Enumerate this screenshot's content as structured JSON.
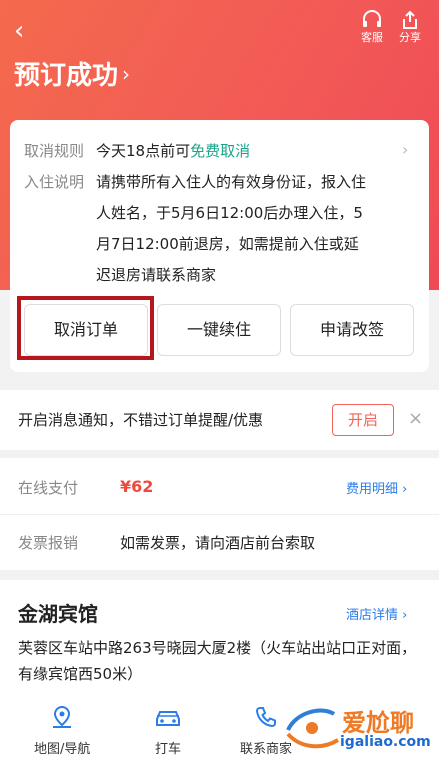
{
  "header": {
    "back_icon": "back-arrow-icon",
    "title": "预订成功",
    "service_label": "客服",
    "share_label": "分享"
  },
  "card": {
    "cancel_rule_label": "取消规则",
    "cancel_rule_prefix": "今天18点前可",
    "cancel_rule_free": "免费取消",
    "checkin_label": "入住说明",
    "checkin_lines": [
      "请携带所有入住人的有效身份证，报入住",
      "人姓名，于5月6日12:00后办理入住，5",
      "月7日12:00前退房，如需提前入住或延",
      "迟退房请联系商家"
    ],
    "buttons": {
      "cancel_order": "取消订单",
      "extend_stay": "一键续住",
      "change_request": "申请改签"
    },
    "highlight_color": "#b5171d"
  },
  "notify": {
    "text": "开启消息通知，不错过订单提醒/优惠",
    "open_label": "开启",
    "close_icon": "close-icon"
  },
  "payment": {
    "online_label": "在线支付",
    "price": "¥62",
    "detail_label": "费用明细 ›",
    "invoice_label": "发票报销",
    "invoice_text": "如需发票，请向酒店前台索取"
  },
  "hotel": {
    "name": "金湖宾馆",
    "detail_link": "酒店详情 ›",
    "address": "芙蓉区车站中路263号晓园大厦2楼（火车站出站口正对面，有缘宾馆西50米）",
    "actions": [
      {
        "label": "地图/导航",
        "icon": "map-pin-icon"
      },
      {
        "label": "打车",
        "icon": "car-icon"
      },
      {
        "label": "联系商家",
        "icon": "phone-icon"
      }
    ]
  },
  "watermark": {
    "text": "爱尬聊",
    "url": "igaliao.com"
  },
  "colors": {
    "header_gradient_start": "#f46a4d",
    "header_gradient_end": "#ef4a55",
    "free_cancel": "#1aa58a",
    "price": "#f0483c",
    "link": "#2b7de9",
    "accent": "#f0625a"
  }
}
